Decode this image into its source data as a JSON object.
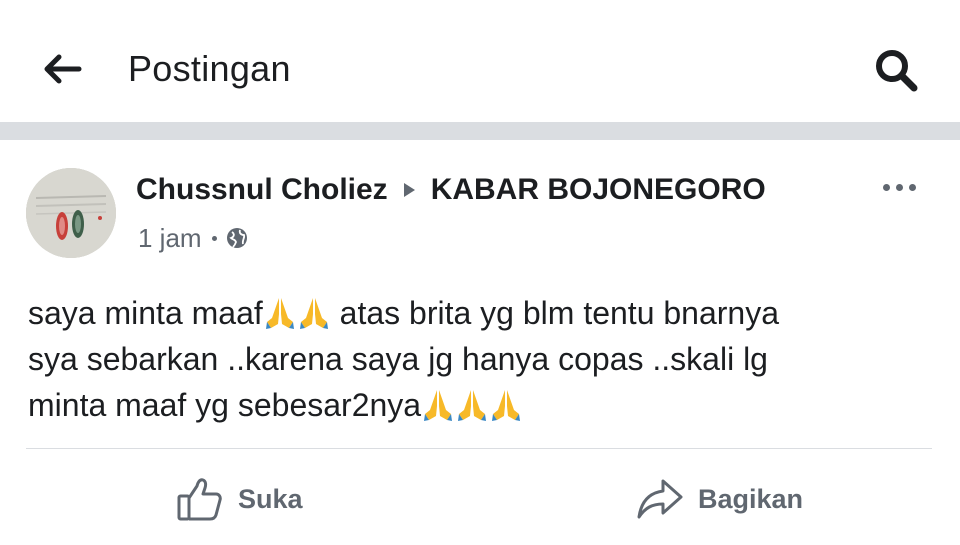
{
  "topbar": {
    "title": "Postingan",
    "back_icon": "arrow-left-icon",
    "search_icon": "search-icon"
  },
  "post": {
    "author": "Chussnul Choliez",
    "group": "KABAR BOJONEGORO",
    "timestamp": "1 jam",
    "privacy_icon": "globe-icon",
    "more_icon": "more-horizontal-icon",
    "text_line1_a": "saya minta maaf",
    "text_line1_b": " atas brita yg blm tentu bnarnya",
    "text_line2": "sya sebarkan ..karena saya jg hanya copas ..skali lg",
    "text_line3": "minta maaf yg sebesar2nya",
    "emoji": "folded-hands-emoji"
  },
  "actions": {
    "like_label": "Suka",
    "share_label": "Bagikan"
  },
  "colors": {
    "text_primary": "#1c1e21",
    "text_secondary": "#606770",
    "divider": "#dadde1",
    "emoji_yellow": "#f7b928",
    "emoji_blue": "#3b88c3"
  }
}
